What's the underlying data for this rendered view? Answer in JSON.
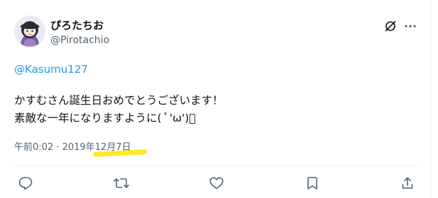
{
  "author": {
    "display_name": "ぴろたちお",
    "handle": "@Pirotachio"
  },
  "tweet": {
    "mention": "@Kasumu127",
    "line1": "かすむさん誕生日おめでとうございます！",
    "line2": "素敵な一年になりますように( ﾟ'ω')ﾟ",
    "timestamp": "午前0:02 · 2019年12月7日",
    "highlight_color": "#ffe81a"
  },
  "colors": {
    "link": "#1d9bf0",
    "secondary_text": "#536471",
    "primary_text": "#0f1419"
  },
  "icons": {
    "header": [
      "grok-icon",
      "more-icon"
    ],
    "actions": [
      "reply-icon",
      "retweet-icon",
      "like-icon",
      "bookmark-icon",
      "share-icon"
    ]
  }
}
